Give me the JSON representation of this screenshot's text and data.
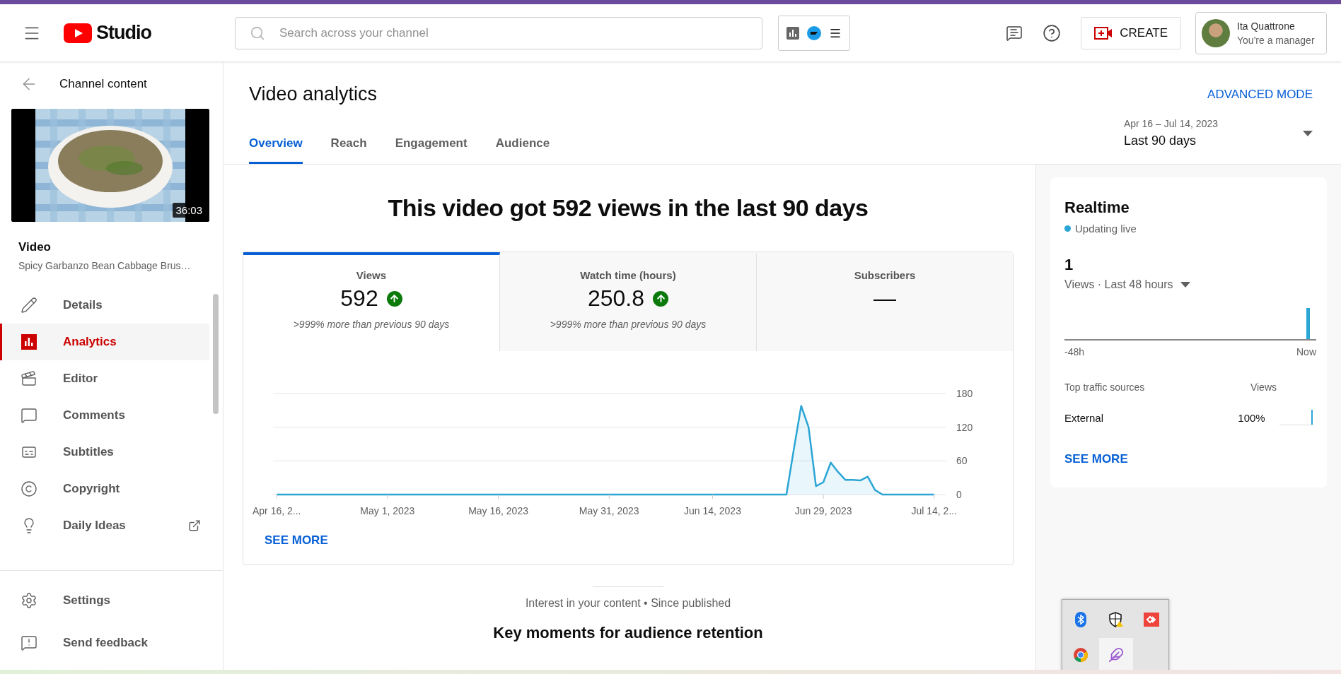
{
  "topbar": {
    "logo_text": "Studio",
    "search": {
      "placeholder": "Search across your channel"
    },
    "create_label": "CREATE",
    "account": {
      "name": "Ita Quattrone",
      "role": "You're a manager"
    }
  },
  "sidebar": {
    "back_label": "Channel content",
    "thumbnail": {
      "kind": "picture",
      "duration": "36:03"
    },
    "video_heading": "Video",
    "video_title": "Spicy Garbanzo Bean Cabbage Brus…",
    "items": [
      {
        "label": "Details",
        "kind": "pencil",
        "selected": false,
        "external": false
      },
      {
        "label": "Analytics",
        "kind": "analytics",
        "selected": true,
        "external": false
      },
      {
        "label": "Editor",
        "kind": "editor",
        "selected": false,
        "external": false
      },
      {
        "label": "Comments",
        "kind": "comments",
        "selected": false,
        "external": false
      },
      {
        "label": "Subtitles",
        "kind": "subtitles",
        "selected": false,
        "external": false
      },
      {
        "label": "Copyright",
        "kind": "copyright",
        "selected": false,
        "external": false
      },
      {
        "label": "Daily Ideas",
        "kind": "ideas",
        "selected": false,
        "external": true
      }
    ],
    "footer_items": [
      {
        "label": "Settings",
        "kind": "settings"
      },
      {
        "label": "Send feedback",
        "kind": "feedback"
      }
    ]
  },
  "page": {
    "title": "Video analytics",
    "advanced_mode": "ADVANCED MODE",
    "tabs": [
      {
        "label": "Overview",
        "selected": true
      },
      {
        "label": "Reach",
        "selected": false
      },
      {
        "label": "Engagement",
        "selected": false
      },
      {
        "label": "Audience",
        "selected": false
      }
    ],
    "date_range": {
      "range": "Apr 16 – Jul 14, 2023",
      "label": "Last 90 days"
    }
  },
  "overview": {
    "headline": "This video got 592 views in the last 90 days",
    "metrics": [
      {
        "label": "Views",
        "value": "592",
        "rising": true,
        "change": ">999% more than previous 90 days",
        "selected": true
      },
      {
        "label": "Watch time (hours)",
        "value": "250.8",
        "rising": true,
        "change": ">999% more than previous 90 days",
        "selected": false
      },
      {
        "label": "Subscribers",
        "value": "—",
        "rising": false,
        "selected": false
      }
    ],
    "chart_data": {
      "type": "area",
      "categories": [
        "Apr 16, 2...",
        null,
        null,
        null,
        null,
        null,
        null,
        null,
        null,
        null,
        null,
        null,
        null,
        null,
        null,
        "May 1, 2023",
        null,
        null,
        null,
        null,
        null,
        null,
        null,
        null,
        null,
        null,
        null,
        null,
        null,
        null,
        "May 16, 2023",
        null,
        null,
        null,
        null,
        null,
        null,
        null,
        null,
        null,
        null,
        null,
        null,
        null,
        null,
        "May 31, 2023",
        null,
        null,
        null,
        null,
        null,
        null,
        null,
        null,
        null,
        null,
        null,
        null,
        null,
        "Jun 14, 2023",
        null,
        null,
        null,
        null,
        null,
        null,
        null,
        null,
        null,
        null,
        null,
        null,
        null,
        null,
        "Jun 29, 2023",
        null,
        null,
        null,
        null,
        null,
        null,
        null,
        null,
        null,
        null,
        null,
        null,
        null,
        null,
        "Jul 14, 2..."
      ],
      "series": [
        {
          "color": "#2ba5d4",
          "values": [
            0,
            0,
            0,
            0,
            0,
            0,
            0,
            0,
            0,
            0,
            0,
            0,
            0,
            0,
            0,
            0,
            0,
            0,
            0,
            0,
            0,
            0,
            0,
            0,
            0,
            0,
            0,
            0,
            0,
            0,
            0,
            0,
            0,
            0,
            0,
            0,
            0,
            0,
            0,
            0,
            0,
            0,
            0,
            0,
            0,
            0,
            0,
            0,
            0,
            0,
            0,
            0,
            0,
            0,
            0,
            0,
            0,
            0,
            0,
            0,
            0,
            0,
            0,
            0,
            0,
            0,
            0,
            0,
            0,
            0,
            80,
            158,
            120,
            15,
            22,
            57,
            40,
            26,
            26,
            25,
            32,
            8,
            0,
            0,
            0,
            0,
            0,
            0,
            0,
            0
          ]
        }
      ],
      "ylim": [
        0,
        180
      ],
      "yticks": [
        0,
        60,
        120,
        180
      ]
    },
    "see_more": "SEE MORE"
  },
  "interest": {
    "caption": "Interest in your content • Since published",
    "heading": "Key moments for audience retention"
  },
  "realtime": {
    "title": "Realtime",
    "status": "Updating live",
    "count": "1",
    "metric_label": "Views · Last 48 hours",
    "axis_start": "-48h",
    "axis_end": "Now",
    "traffic": {
      "header_source": "Top traffic sources",
      "header_views": "Views",
      "rows": [
        {
          "source": "External",
          "share": "100%",
          "level": 1
        }
      ]
    },
    "see_more": "SEE MORE"
  },
  "tray": {
    "icons": [
      {
        "kind": "bluetooth",
        "selected": false
      },
      {
        "kind": "shield",
        "selected": false
      },
      {
        "kind": "remote",
        "selected": false
      },
      {
        "kind": "browser",
        "selected": false
      },
      {
        "kind": "feather",
        "selected": true
      }
    ]
  }
}
